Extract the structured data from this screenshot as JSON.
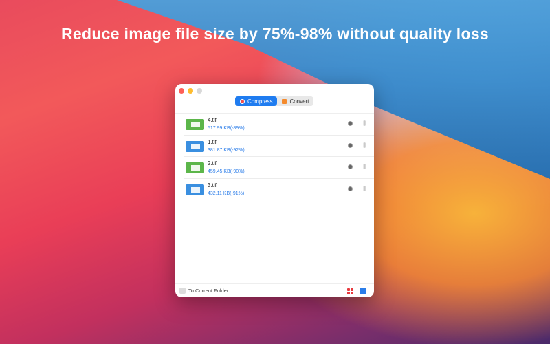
{
  "headline": "Reduce image file size by 75%-98% without quality loss",
  "tabs": [
    {
      "label": "Compress",
      "active": true
    },
    {
      "label": "Convert",
      "active": false
    }
  ],
  "files": [
    {
      "name": "4.tif",
      "size": "517.99 KB(-89%)",
      "thumb_color": "#5cb64a"
    },
    {
      "name": "1.tif",
      "size": "381.87 KB(-92%)",
      "thumb_color": "#3a8fe0"
    },
    {
      "name": "2.tif",
      "size": "459.45 KB(-90%)",
      "thumb_color": "#5cb64a"
    },
    {
      "name": "3.tif",
      "size": "432.11 KB(-91%)",
      "thumb_color": "#3a8fe0"
    }
  ],
  "footer": {
    "checkbox_label": "To Current Folder",
    "checked": false
  }
}
